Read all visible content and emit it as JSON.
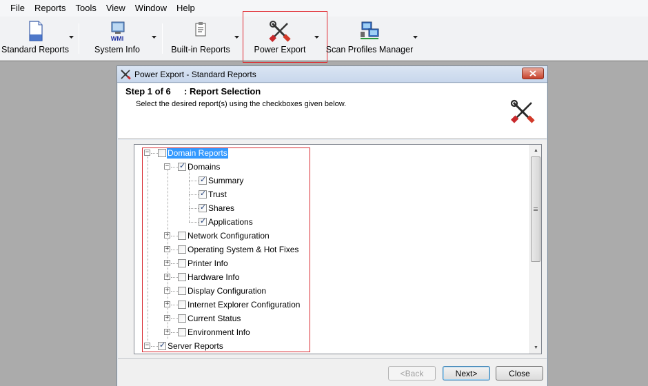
{
  "menubar": {
    "items": [
      "File",
      "Reports",
      "Tools",
      "View",
      "Window",
      "Help"
    ]
  },
  "toolbar": {
    "buttons": [
      {
        "label": "Standard Reports",
        "icon": "document-icon"
      },
      {
        "label": "System Info",
        "icon": "wmi-icon"
      },
      {
        "label": "Built-in Reports",
        "icon": "clipboard-report-icon"
      },
      {
        "label": "Power Export",
        "icon": "wrench-screwdriver-icon"
      },
      {
        "label": "Scan Profiles Manager",
        "icon": "network-computers-icon"
      }
    ]
  },
  "dialog": {
    "title": "Power Export - Standard Reports",
    "step_label": "Step 1 of 6",
    "step_title": ": Report Selection",
    "step_desc": "Select the desired report(s) using the checkboxes given below.",
    "tree": {
      "root": {
        "label": "Domain Reports",
        "checked": false,
        "selected": true,
        "expanded": true
      },
      "domains": {
        "label": "Domains",
        "checked": true,
        "expanded": true
      },
      "domain_children": [
        {
          "label": "Summary",
          "checked": true
        },
        {
          "label": "Trust",
          "checked": true
        },
        {
          "label": "Shares",
          "checked": true
        },
        {
          "label": "Applications",
          "checked": true
        }
      ],
      "categories": [
        {
          "label": "Network Configuration",
          "checked": false
        },
        {
          "label": "Operating System & Hot Fixes",
          "checked": false
        },
        {
          "label": "Printer Info",
          "checked": false
        },
        {
          "label": "Hardware Info",
          "checked": false
        },
        {
          "label": "Display Configuration",
          "checked": false
        },
        {
          "label": "Internet Explorer Configuration",
          "checked": false
        },
        {
          "label": "Current Status",
          "checked": false
        },
        {
          "label": "Environment Info",
          "checked": false
        }
      ],
      "server": {
        "label": "Server Reports",
        "checked": true,
        "expanded": true
      }
    },
    "buttons": {
      "back": "<Back",
      "next": "Next>",
      "close": "Close"
    }
  },
  "colors": {
    "highlight_red": "#e0232a",
    "selection_blue": "#3399ff",
    "app_background": "#ababab"
  }
}
